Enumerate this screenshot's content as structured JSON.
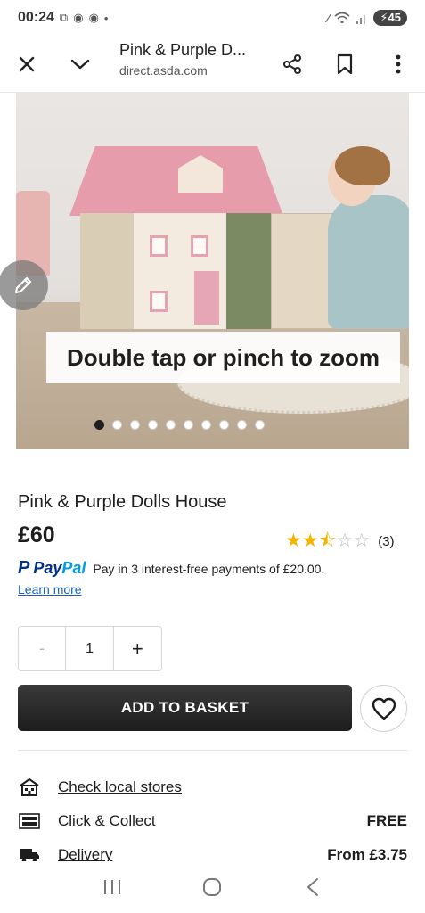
{
  "status_bar": {
    "time": "00:24",
    "notification_icons": [
      "screenshot-icon",
      "messenger-icon",
      "messenger-icon"
    ],
    "dot": "•",
    "battery": "45"
  },
  "custom_tab": {
    "title": "Pink & Purple D...",
    "url": "direct.asda.com"
  },
  "carousel": {
    "zoom_hint": "Double tap or pinch to zoom",
    "slide_count": 10,
    "active_slide": 1
  },
  "product": {
    "name": "Pink & Purple Dolls House",
    "price": "£60",
    "rating": 2.5,
    "rating_max": 5,
    "review_count": "(3)"
  },
  "paypal": {
    "brand_pay": "Pay",
    "brand_pal": "Pal",
    "text": "Pay in 3 interest-free payments of £20.00.",
    "learn_more": "Learn more"
  },
  "quantity": {
    "minus": "-",
    "value": "1",
    "plus": "+"
  },
  "actions": {
    "add_to_basket": "ADD TO BASKET"
  },
  "fulfilment": [
    {
      "icon": "store-icon",
      "label": "Check local stores",
      "value": ""
    },
    {
      "icon": "click-collect-icon",
      "label": "Click & Collect",
      "value": "FREE"
    },
    {
      "icon": "delivery-truck-icon",
      "label": "Delivery",
      "value": "From £3.75"
    }
  ],
  "colors": {
    "accent_dark": "#1d1d1d",
    "star": "#f4b400",
    "paypal_dark": "#003087",
    "paypal_light": "#009cde",
    "link": "#1a5fb4"
  }
}
